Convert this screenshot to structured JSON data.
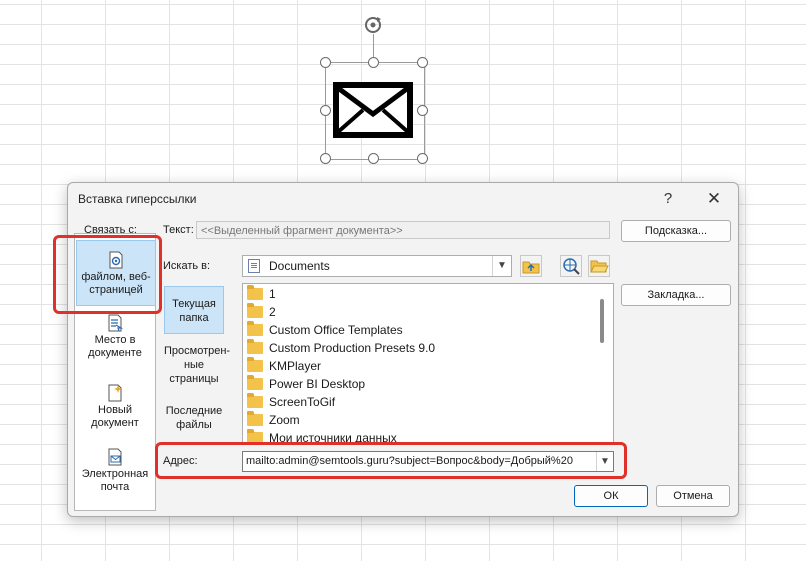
{
  "dialog": {
    "title": "Вставка гиперссылки",
    "help_glyph": "?",
    "close_glyph": "✕"
  },
  "link_to": {
    "label": "Связать с:",
    "items": [
      {
        "label_line1": "файлом, веб-",
        "label_line2": "страницей",
        "icon": "file-web-icon",
        "selected": true
      },
      {
        "label_line1": "Место в",
        "label_line2": "документе",
        "icon": "document-place-icon",
        "selected": false
      },
      {
        "label_line1": "Новый",
        "label_line2": "документ",
        "icon": "new-document-icon",
        "selected": false
      },
      {
        "label_line1": "Электронная",
        "label_line2": "почта",
        "icon": "email-icon",
        "selected": false
      }
    ]
  },
  "text_field": {
    "label": "Текст:",
    "value": "<<Выделенный фрагмент документа>>"
  },
  "buttons": {
    "tooltip": "Подсказка...",
    "bookmark": "Закладка...",
    "ok": "ОК",
    "cancel": "Отмена"
  },
  "look_in": {
    "label": "Искать в:",
    "value": "Documents",
    "items": [
      {
        "line1": "Текущая",
        "line2": "папка",
        "line3": "",
        "selected": true
      },
      {
        "line1": "Просмотрен-",
        "line2": "ные",
        "line3": "страницы",
        "selected": false
      },
      {
        "line1": "Последние",
        "line2": "файлы",
        "line3": "",
        "selected": false
      }
    ]
  },
  "files": [
    "1",
    "2",
    "Custom Office Templates",
    "Custom Production Presets 9.0",
    "KMPlayer",
    "Power BI Desktop",
    "ScreenToGif",
    "Zoom",
    "Мои источники данных"
  ],
  "address": {
    "label": "Адрес:",
    "value": "mailto:admin@semtools.guru?subject=Вопрос&body=Добрый%20"
  },
  "colors": {
    "highlight": "#e0302a",
    "selection": "#cce4f7"
  }
}
